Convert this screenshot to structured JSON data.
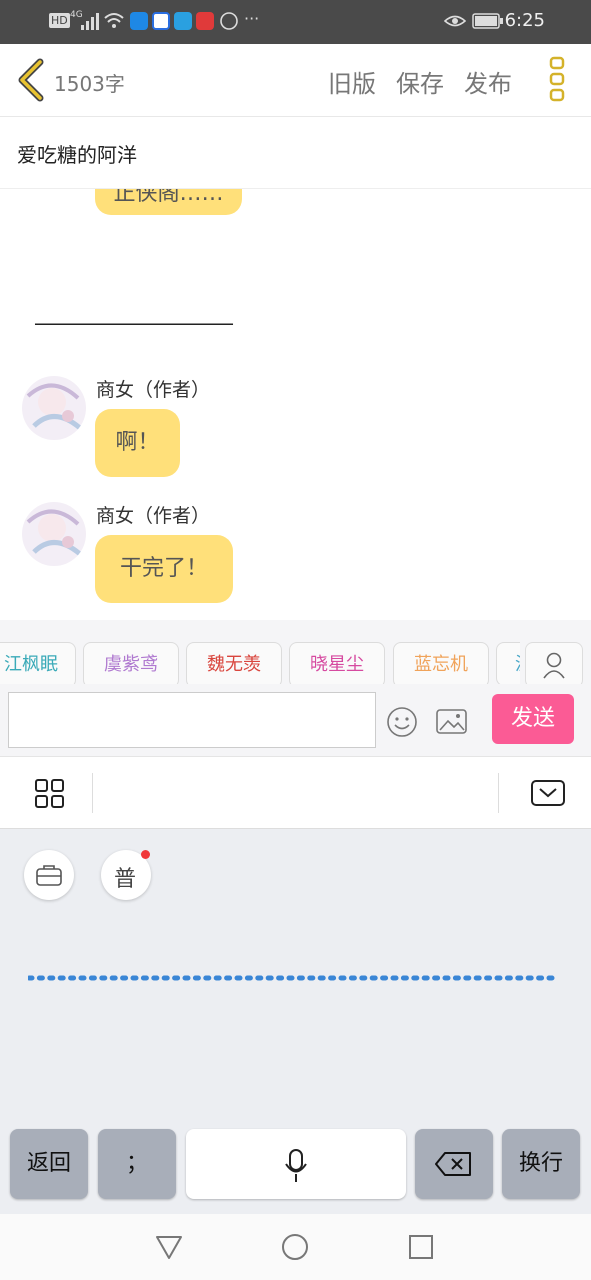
{
  "status_bar": {
    "time": "6:25",
    "network": "4G",
    "hd": "HD"
  },
  "header": {
    "word_count": "1503字",
    "old_version": "旧版",
    "save": "保存",
    "publish": "发布"
  },
  "title": "爱吃糖的阿洋",
  "chat": {
    "partial_bubble_text": "正侠阁……",
    "separator": "———————————",
    "messages": [
      {
        "speaker": "商女（作者）",
        "text": "啊！"
      },
      {
        "speaker": "商女（作者）",
        "text": "干完了！"
      }
    ]
  },
  "characters": [
    {
      "name": "江枫眠",
      "color": "#3aaab8"
    },
    {
      "name": "虞紫鸢",
      "color": "#b07ad0"
    },
    {
      "name": "魏无羡",
      "color": "#d9463e"
    },
    {
      "name": "晓星尘",
      "color": "#d64aa0"
    },
    {
      "name": "蓝忘机",
      "color": "#f0a35a"
    },
    {
      "name": "温",
      "color": "#4aa8c8"
    }
  ],
  "composer": {
    "input_value": "",
    "send": "发送"
  },
  "keyboard": {
    "mode_badge": "普",
    "keys": {
      "back": "返回",
      "semicolon": "；",
      "newline": "换行"
    }
  },
  "colors": {
    "bubble": "#ffe07a",
    "send": "#fb5b95",
    "accent_back": "#e8c331"
  }
}
